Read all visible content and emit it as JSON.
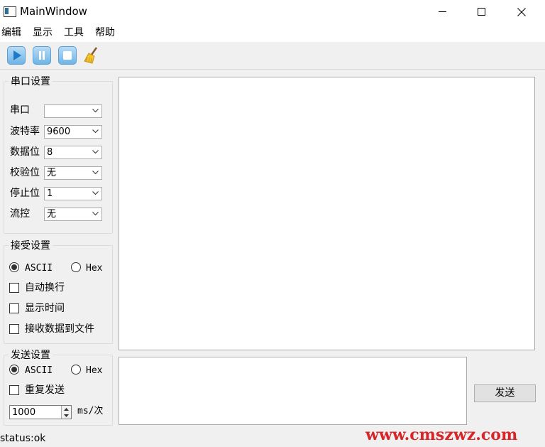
{
  "window": {
    "title": "MainWindow"
  },
  "menu": {
    "items": [
      "编辑",
      "显示",
      "工具",
      "帮助"
    ]
  },
  "toolbar": {
    "buttons": [
      "play-icon",
      "pause-icon",
      "stop-icon",
      "broom-icon"
    ]
  },
  "serial_settings": {
    "title": "串口设置",
    "fields": [
      {
        "label": "串口",
        "value": ""
      },
      {
        "label": "波特率",
        "value": "9600"
      },
      {
        "label": "数据位",
        "value": "8"
      },
      {
        "label": "校验位",
        "value": "无"
      },
      {
        "label": "停止位",
        "value": "1"
      },
      {
        "label": "流控",
        "value": "无"
      }
    ]
  },
  "receive_settings": {
    "title": "接受设置",
    "mode_ascii": "ASCII",
    "mode_hex": "Hex",
    "selected_mode": "ASCII",
    "options": [
      {
        "label": "自动换行",
        "checked": false
      },
      {
        "label": "显示时间",
        "checked": false
      },
      {
        "label": "接收数据到文件",
        "checked": false
      }
    ]
  },
  "send_settings": {
    "title": "发送设置",
    "mode_ascii": "ASCII",
    "mode_hex": "Hex",
    "selected_mode": "ASCII",
    "repeat_label": "重复发送",
    "repeat_checked": false,
    "interval_value": "1000",
    "interval_unit": "ms/次"
  },
  "send_button": {
    "label": "发送"
  },
  "status": {
    "text": "status:ok"
  },
  "watermark": {
    "text": "www.cmszwz.com"
  },
  "colors": {
    "window_bg": "#f0f0f0",
    "titlebar_bg": "#ffffff",
    "toolbar_icon": "#4aa3df",
    "watermark": "#d8252a"
  }
}
